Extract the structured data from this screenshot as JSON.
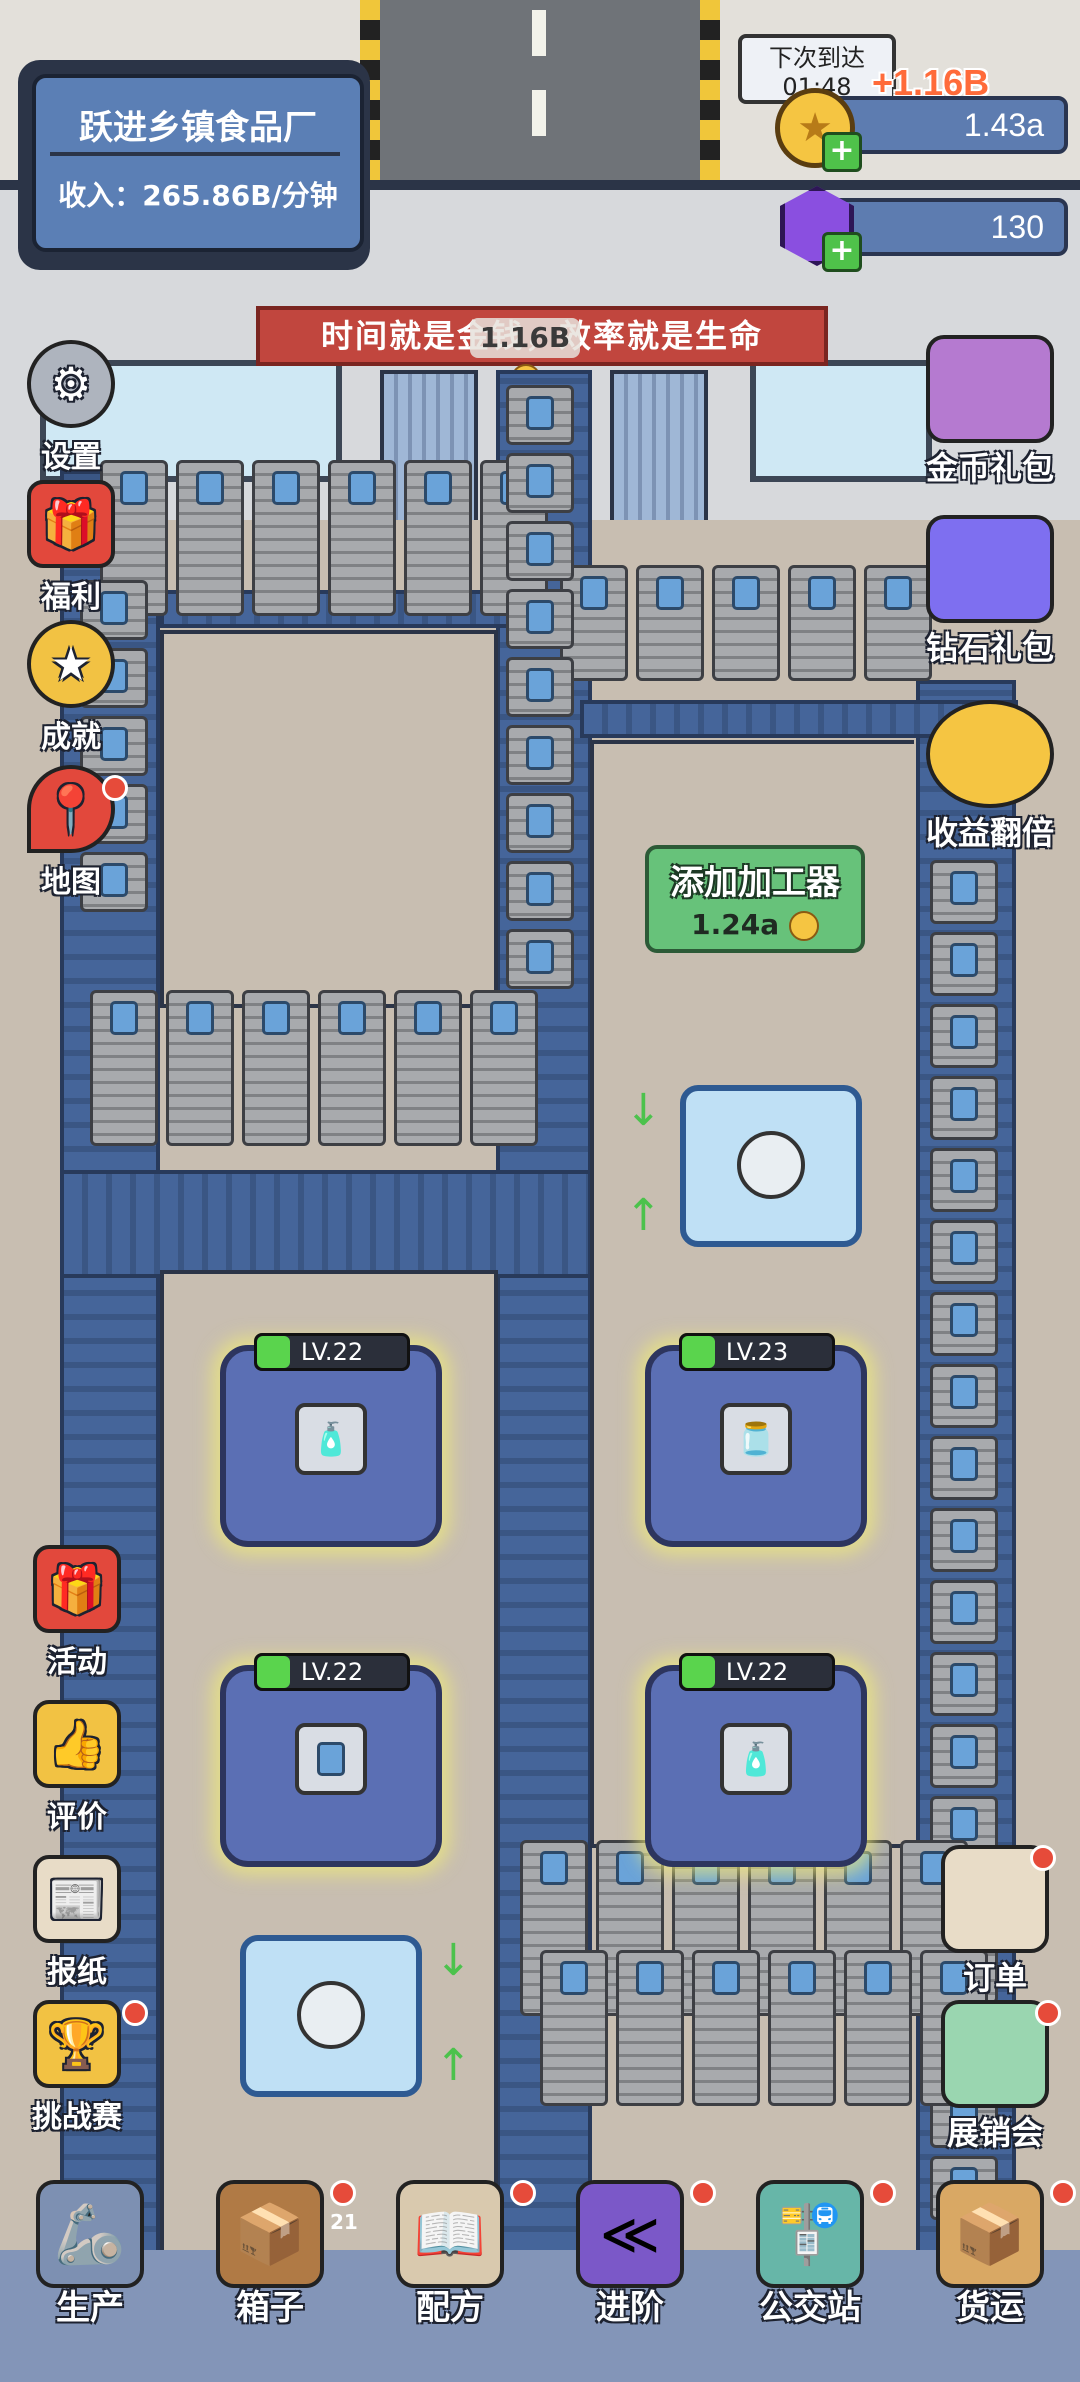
{
  "factory": {
    "name": "跃进乡镇食品厂",
    "income": "收入：265.86B/分钟"
  },
  "next_arrival": {
    "label": "下次到达",
    "time": "01:48"
  },
  "gold": {
    "gain": "+1.16B",
    "value": "1.43a"
  },
  "gems": {
    "value": "130"
  },
  "banner": {
    "text": "时间就是金钱，效率就是生命",
    "floating_value": "1.16B"
  },
  "side_menu_left": [
    {
      "label": "设置"
    },
    {
      "label": "福利"
    },
    {
      "label": "成就"
    },
    {
      "label": "地图"
    }
  ],
  "side_menu_left_bottom": [
    {
      "label": "活动"
    },
    {
      "label": "评价"
    },
    {
      "label": "报纸"
    },
    {
      "label": "挑战赛"
    }
  ],
  "side_menu_right": [
    {
      "label": "金币礼包"
    },
    {
      "label": "钻石礼包"
    },
    {
      "label": "收益翻倍"
    }
  ],
  "side_menu_right_bottom": [
    {
      "label": "订单"
    },
    {
      "label": "展销会"
    }
  ],
  "add_processor": {
    "label": "添加加工器",
    "cost": "1.24a"
  },
  "machines": [
    {
      "level": "LV.22"
    },
    {
      "level": "LV.23"
    },
    {
      "level": "LV.22"
    },
    {
      "level": "LV.22"
    }
  ],
  "box_count": "21",
  "bottom_nav": [
    {
      "label": "生产"
    },
    {
      "label": "箱子"
    },
    {
      "label": "配方"
    },
    {
      "label": "进阶"
    },
    {
      "label": "公交站"
    },
    {
      "label": "货运"
    }
  ],
  "colors": {
    "belt": "#45659a",
    "gold": "#f5c542",
    "gem": "#8a4fe0",
    "green_button": "#5fbf73",
    "red_dot": "#e64b3a"
  }
}
